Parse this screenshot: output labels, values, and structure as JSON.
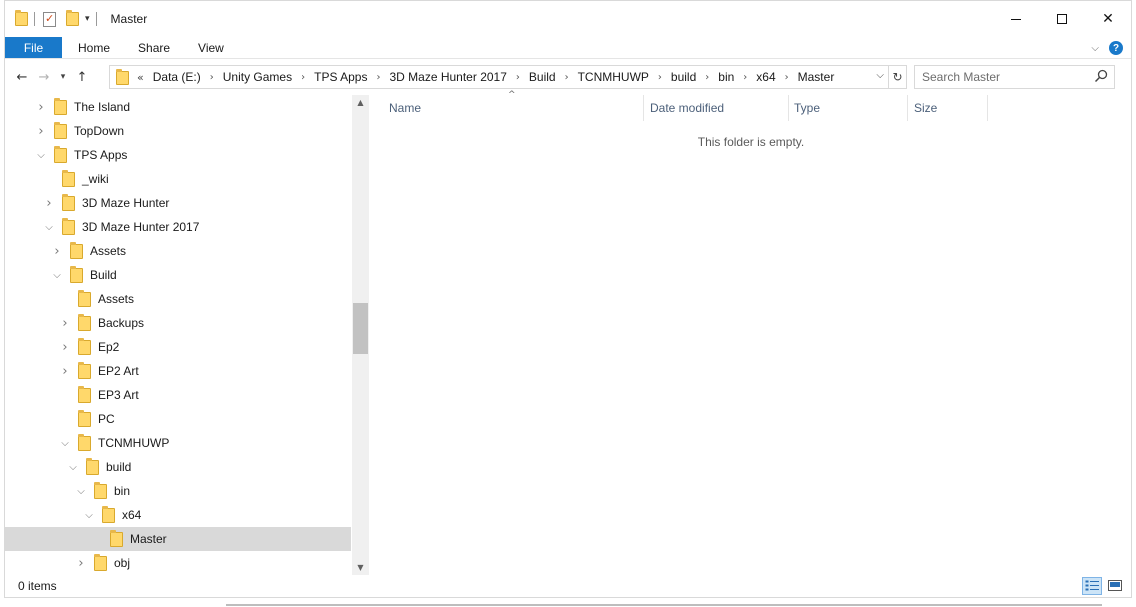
{
  "window": {
    "title": "Master"
  },
  "ribbon": {
    "file": "File",
    "tabs": [
      "Home",
      "Share",
      "View"
    ]
  },
  "address": {
    "lead": "«",
    "crumbs": [
      "Data (E:)",
      "Unity Games",
      "TPS Apps",
      "3D Maze Hunter 2017",
      "Build",
      "TCNMHUWP",
      "build",
      "bin",
      "x64",
      "Master"
    ]
  },
  "search": {
    "placeholder": "Search Master"
  },
  "tree": {
    "items": [
      {
        "label": "The Island",
        "state": "collapsed"
      },
      {
        "label": "TopDown",
        "state": "collapsed"
      },
      {
        "label": "TPS Apps",
        "state": "expanded"
      },
      {
        "label": "_wiki",
        "state": "none"
      },
      {
        "label": "3D Maze Hunter",
        "state": "collapsed"
      },
      {
        "label": "3D Maze Hunter 2017",
        "state": "expanded"
      },
      {
        "label": "Assets",
        "state": "collapsed"
      },
      {
        "label": "Build",
        "state": "expanded"
      },
      {
        "label": "Assets",
        "state": "none"
      },
      {
        "label": "Backups",
        "state": "collapsed"
      },
      {
        "label": "Ep2",
        "state": "collapsed"
      },
      {
        "label": "EP2 Art",
        "state": "collapsed"
      },
      {
        "label": "EP3 Art",
        "state": "none"
      },
      {
        "label": "PC",
        "state": "none"
      },
      {
        "label": "TCNMHUWP",
        "state": "expanded"
      },
      {
        "label": "build",
        "state": "expanded"
      },
      {
        "label": "bin",
        "state": "expanded"
      },
      {
        "label": "x64",
        "state": "expanded"
      },
      {
        "label": "Master",
        "state": "none",
        "selected": true
      },
      {
        "label": "obj",
        "state": "collapsed"
      }
    ]
  },
  "columns": [
    "Name",
    "Date modified",
    "Type",
    "Size"
  ],
  "content": {
    "empty_message": "This folder is empty."
  },
  "status": {
    "item_count": "0 items"
  },
  "colors": {
    "accent": "#1979ca",
    "folder": "#ffd86b",
    "selection": "#d9d9d9"
  }
}
